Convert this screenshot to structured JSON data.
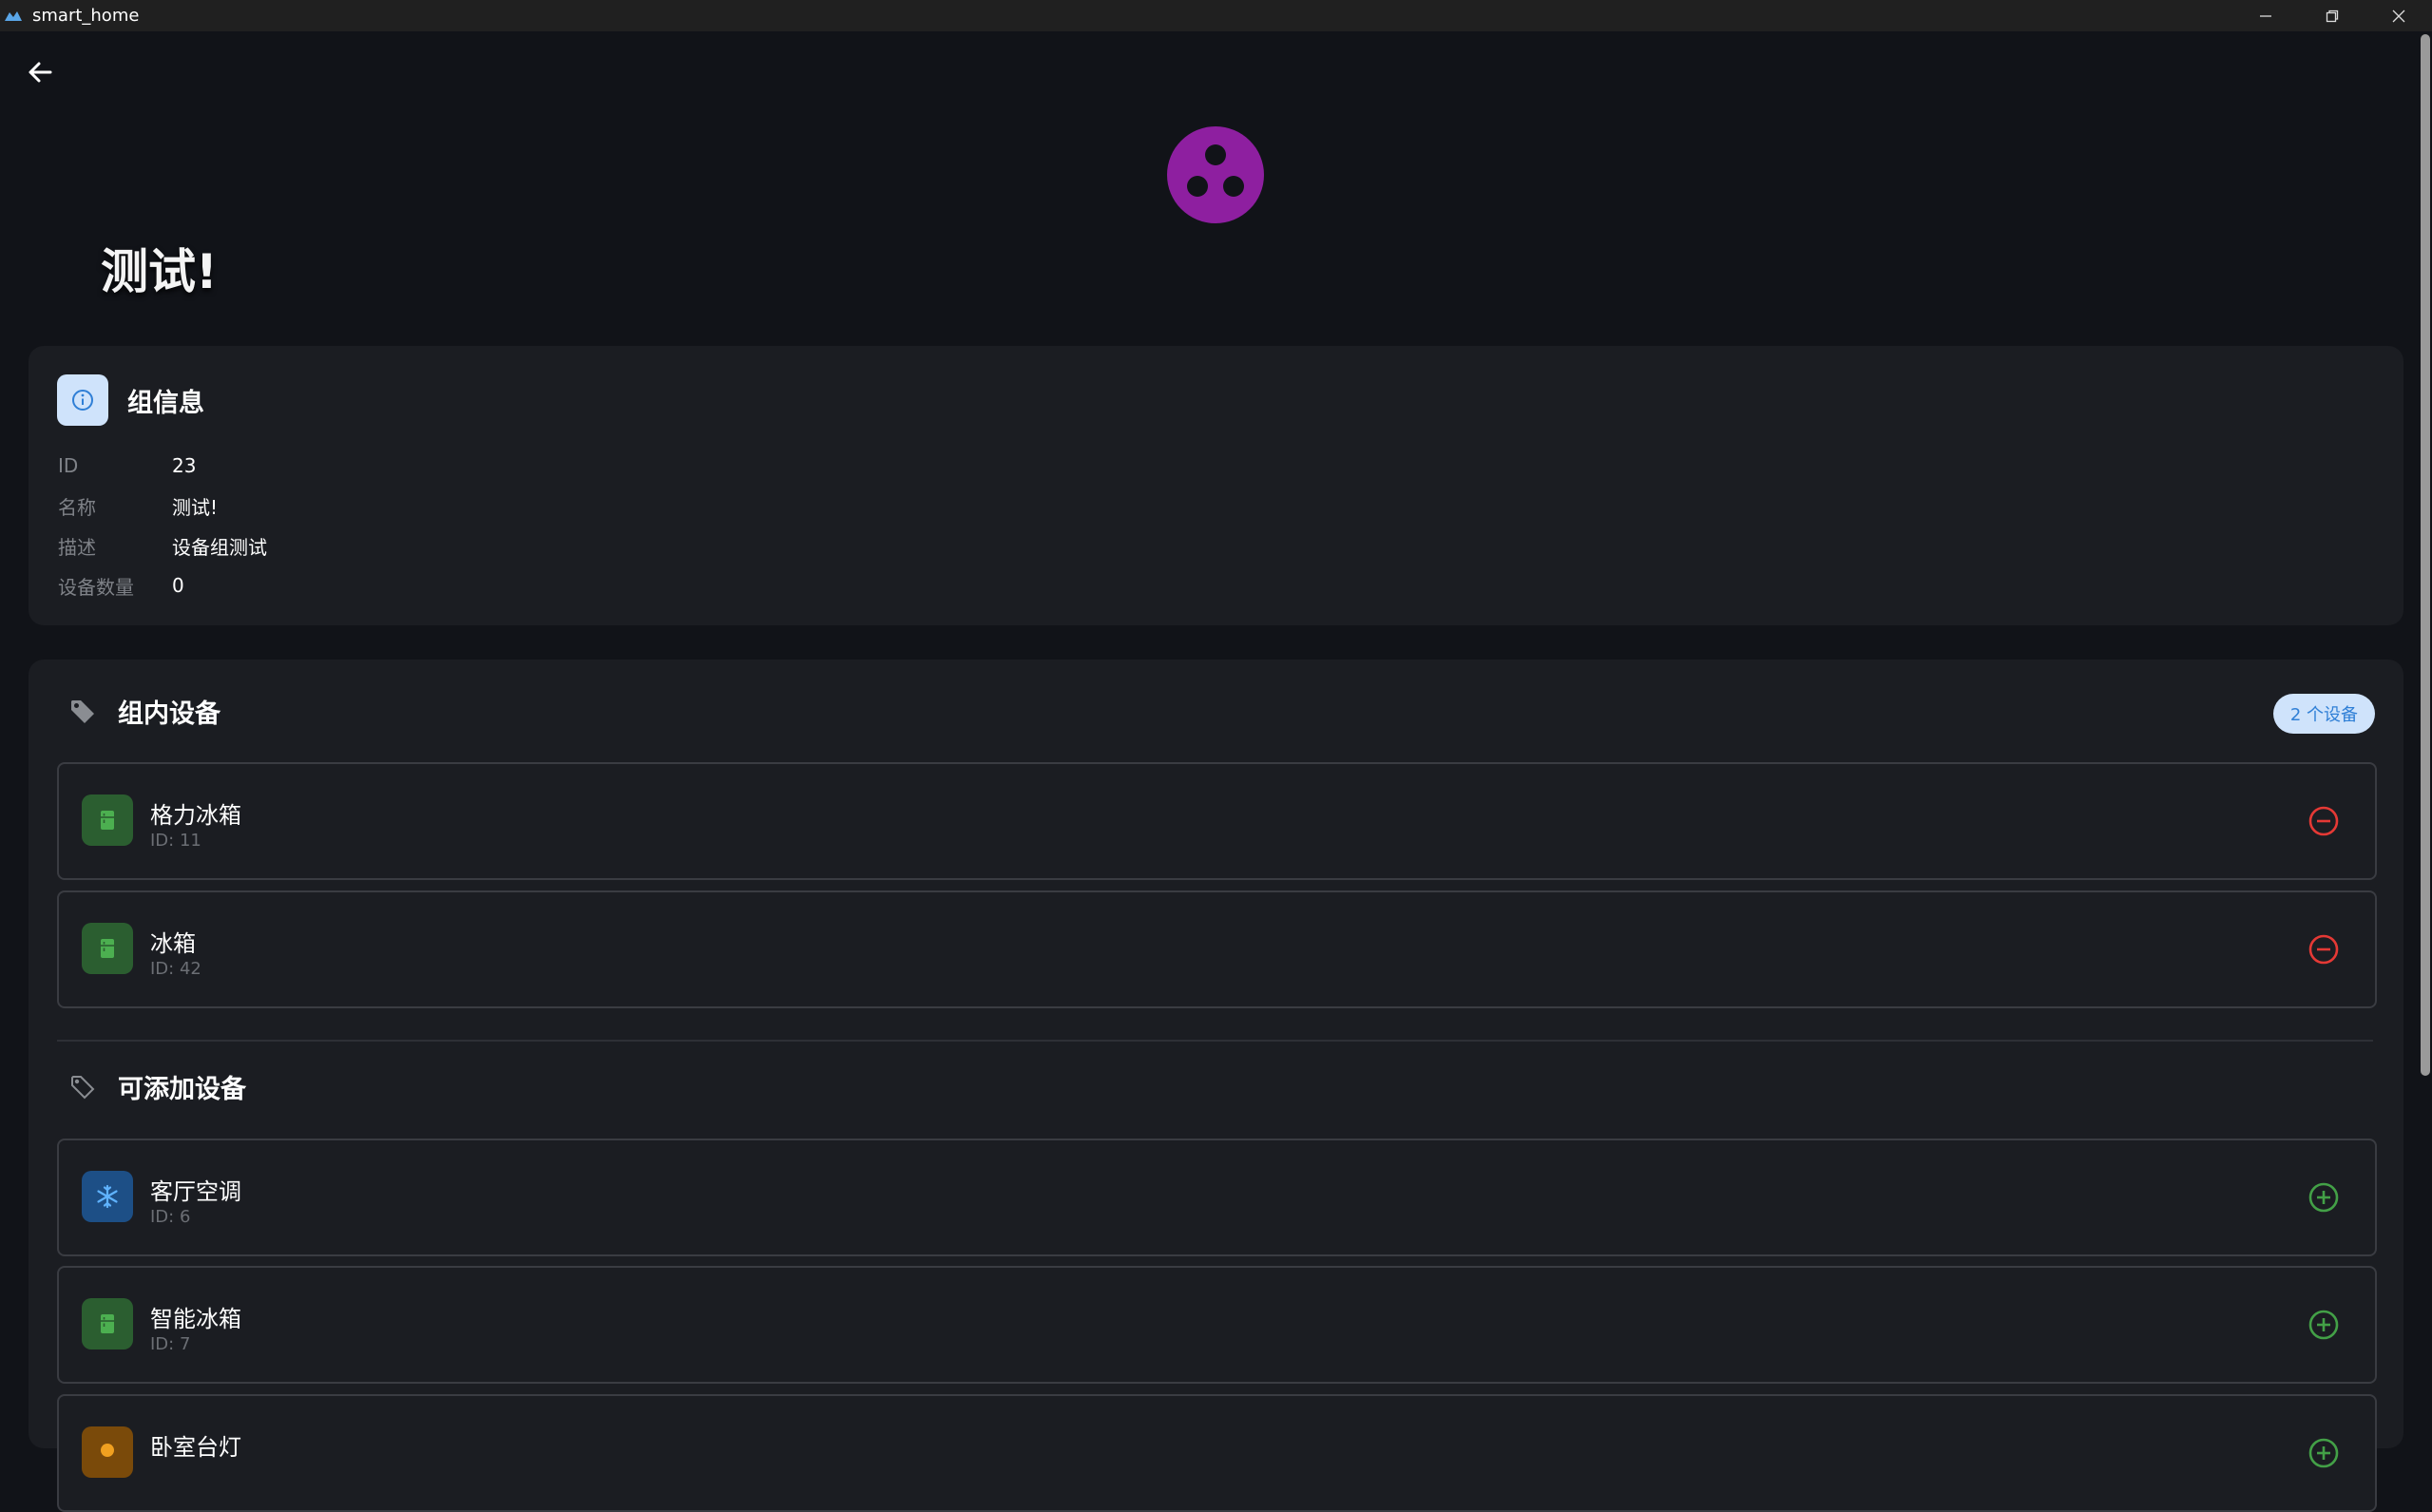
{
  "window": {
    "title": "smart_home"
  },
  "page": {
    "title": "测试!"
  },
  "group_info": {
    "title": "组信息",
    "rows": [
      {
        "label": "ID",
        "value": "23"
      },
      {
        "label": "名称",
        "value": "测试!"
      },
      {
        "label": "描述",
        "value": "设备组测试"
      },
      {
        "label": "设备数量",
        "value": "0"
      }
    ]
  },
  "group_devices": {
    "title": "组内设备",
    "count_badge": "2 个设备",
    "items": [
      {
        "name": "格力冰箱",
        "id": "ID: 11",
        "icon": "fridge-icon"
      },
      {
        "name": "冰箱",
        "id": "ID: 42",
        "icon": "fridge-icon"
      }
    ]
  },
  "available_devices": {
    "title": "可添加设备",
    "items": [
      {
        "name": "客厅空调",
        "id": "ID: 6",
        "icon": "snowflake-icon"
      },
      {
        "name": "智能冰箱",
        "id": "ID: 7",
        "icon": "fridge-icon"
      },
      {
        "name": "卧室台灯",
        "id": "",
        "icon": "lamp-icon"
      }
    ]
  },
  "colors": {
    "background": "#111318",
    "card": "#1b1d22",
    "accent_purple": "#8e1fa0",
    "remove_red": "#e53935",
    "add_green": "#43a047",
    "badge_bg": "#cfe3fb",
    "badge_text": "#2f7fd6"
  }
}
